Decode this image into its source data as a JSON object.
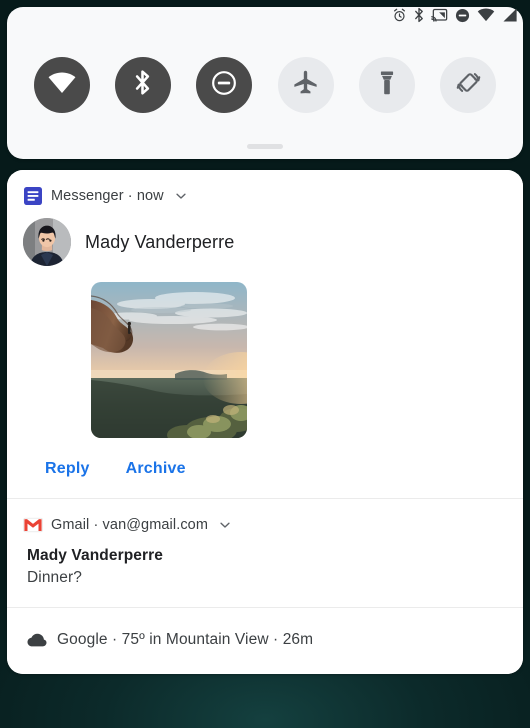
{
  "statusbar": {
    "icons": [
      {
        "name": "alarm-icon",
        "label": "alarm"
      },
      {
        "name": "bluetooth-icon",
        "label": "bluetooth"
      },
      {
        "name": "cast-icon",
        "label": "cast"
      },
      {
        "name": "do-not-disturb-icon",
        "label": "do not disturb"
      },
      {
        "name": "wifi-icon",
        "label": "wifi"
      },
      {
        "name": "cell-signal-icon",
        "label": "signal"
      }
    ]
  },
  "quick_settings": {
    "tiles": [
      {
        "name": "wifi-tile",
        "label": "Wi-Fi",
        "state": "on"
      },
      {
        "name": "bluetooth-tile",
        "label": "Bluetooth",
        "state": "on"
      },
      {
        "name": "do-not-disturb-tile",
        "label": "Do Not Disturb",
        "state": "on"
      },
      {
        "name": "airplane-mode-tile",
        "label": "Airplane mode",
        "state": "off"
      },
      {
        "name": "flashlight-tile",
        "label": "Flashlight",
        "state": "off"
      },
      {
        "name": "auto-rotate-tile",
        "label": "Auto-rotate",
        "state": "off"
      }
    ],
    "handle_label": "Drag handle",
    "colors": {
      "tile_on": "#4a4a4a",
      "tile_off": "#e8eaed",
      "panel_bg": "#f8f9fa"
    }
  },
  "notifications": [
    {
      "app_name": "Messenger",
      "header_text": "Messenger · now",
      "icon": "messenger-icon",
      "expand_icon": "chevron-down-icon",
      "sender": "Mady Vanderperre",
      "image_alt": "Sunset over cliff and valley landscape",
      "actions": [
        {
          "label": "Reply",
          "name": "reply-button"
        },
        {
          "label": "Archive",
          "name": "archive-button"
        }
      ],
      "accent_color": "#1a73e8"
    },
    {
      "app_name": "Gmail",
      "header_text": "Gmail · van@gmail.com",
      "icon": "gmail-icon",
      "expand_icon": "chevron-down-icon",
      "title": "Mady Vanderperre",
      "text": "Dinner?"
    },
    {
      "app_name": "Google",
      "header_text": "Google · 75º in Mountain View · 26m",
      "icon": "cloud-icon"
    }
  ]
}
